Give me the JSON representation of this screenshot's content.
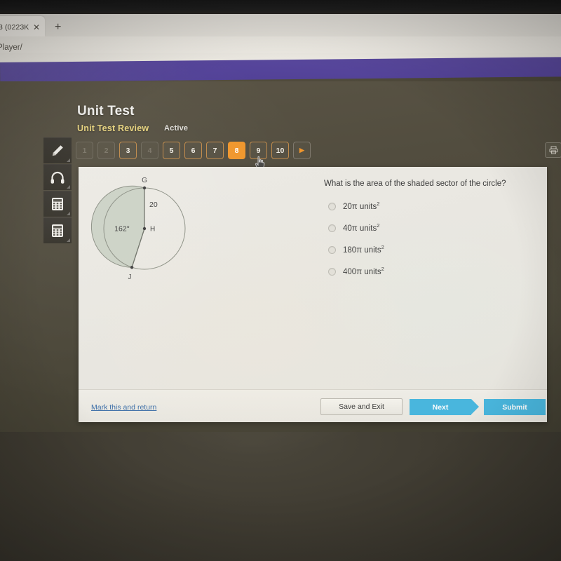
{
  "browser": {
    "tab_title": "3 (0223K",
    "tab_close_icon": "close-icon",
    "new_tab_icon": "plus-icon",
    "url_text": "Player/"
  },
  "header": {
    "title": "Unit Test",
    "subtitle": "Unit Test Review",
    "status": "Active",
    "print_icon": "printer-icon"
  },
  "pager": {
    "items": [
      {
        "label": "1",
        "state": "dim"
      },
      {
        "label": "2",
        "state": "dim"
      },
      {
        "label": "3",
        "state": "norm"
      },
      {
        "label": "4",
        "state": "dim"
      },
      {
        "label": "5",
        "state": "norm"
      },
      {
        "label": "6",
        "state": "norm"
      },
      {
        "label": "7",
        "state": "norm"
      },
      {
        "label": "8",
        "state": "active"
      },
      {
        "label": "9",
        "state": "norm"
      },
      {
        "label": "10",
        "state": "norm"
      }
    ],
    "next_arrow_label": "▶",
    "active_question": "8"
  },
  "tools": [
    {
      "icon": "pencil-icon",
      "name": "highlighter-tool"
    },
    {
      "icon": "headphones-icon",
      "name": "audio-tool"
    },
    {
      "icon": "calculator-icon",
      "name": "calculator-tool"
    },
    {
      "icon": "calculator-icon",
      "name": "scientific-calculator-tool"
    }
  ],
  "figure": {
    "center_label": "H",
    "top_point_label": "G",
    "bottom_point_label": "J",
    "radius_label": "20",
    "angle_label": "162°",
    "shaded_fill": "#ccd2c6",
    "stroke": "#7d8177"
  },
  "question": {
    "prompt": "What is the area of the shaded sector of the circle?",
    "choices": [
      {
        "value": "20",
        "unit": "π units",
        "exp": "2"
      },
      {
        "value": "40",
        "unit": "π units",
        "exp": "2"
      },
      {
        "value": "180",
        "unit": "π units",
        "exp": "2"
      },
      {
        "value": "400",
        "unit": "π units",
        "exp": "2"
      }
    ],
    "selected": null
  },
  "footer": {
    "mark_link": "Mark this and return",
    "save_label": "Save and Exit",
    "next_label": "Next",
    "submit_label": "Submit"
  },
  "colors": {
    "accent_orange": "#f0962c",
    "banner_purple": "#55449a",
    "button_blue": "#49b6dd",
    "link_blue": "#3d6fa8",
    "subtitle_gold": "#e8d47f"
  }
}
